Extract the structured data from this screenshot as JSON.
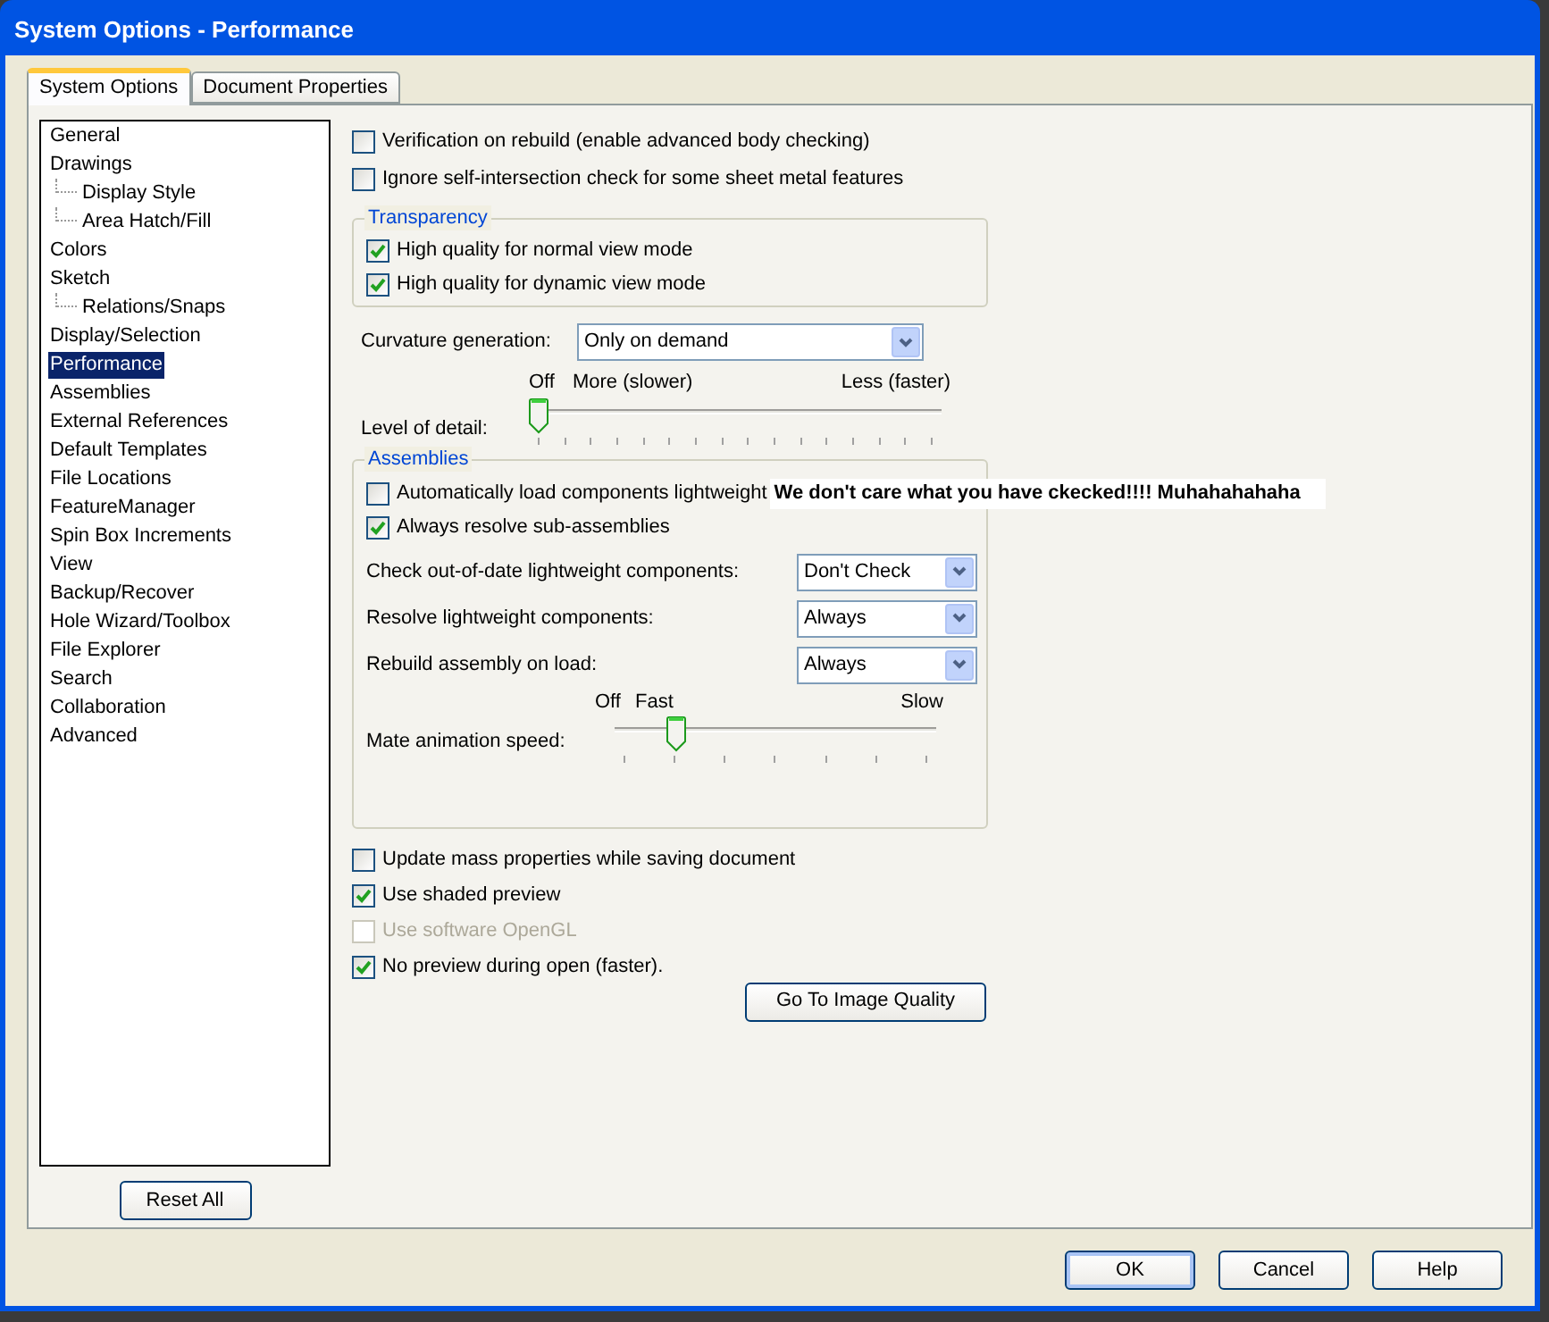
{
  "window": {
    "title": "System Options - Performance"
  },
  "tabs": [
    {
      "label": "System Options",
      "selected": true
    },
    {
      "label": "Document Properties",
      "selected": false
    }
  ],
  "sidebar": {
    "items": [
      {
        "label": "General",
        "selected": false
      },
      {
        "label": "Drawings",
        "selected": false,
        "children": [
          {
            "label": "Display Style",
            "selected": false
          },
          {
            "label": "Area Hatch/Fill",
            "selected": false
          }
        ]
      },
      {
        "label": "Colors",
        "selected": false
      },
      {
        "label": "Sketch",
        "selected": false,
        "children": [
          {
            "label": "Relations/Snaps",
            "selected": false
          }
        ]
      },
      {
        "label": "Display/Selection",
        "selected": false
      },
      {
        "label": "Performance",
        "selected": true
      },
      {
        "label": "Assemblies",
        "selected": false
      },
      {
        "label": "External References",
        "selected": false
      },
      {
        "label": "Default Templates",
        "selected": false
      },
      {
        "label": "File Locations",
        "selected": false
      },
      {
        "label": "FeatureManager",
        "selected": false
      },
      {
        "label": "Spin Box Increments",
        "selected": false
      },
      {
        "label": "View",
        "selected": false
      },
      {
        "label": "Backup/Recover",
        "selected": false
      },
      {
        "label": "Hole Wizard/Toolbox",
        "selected": false
      },
      {
        "label": "File Explorer",
        "selected": false
      },
      {
        "label": "Search",
        "selected": false
      },
      {
        "label": "Collaboration",
        "selected": false
      },
      {
        "label": "Advanced",
        "selected": false
      }
    ],
    "reset_button": "Reset All"
  },
  "top_options": [
    {
      "label": "Verification on rebuild (enable advanced body checking)",
      "checked": false,
      "disabled": false
    },
    {
      "label": "Ignore self-intersection check for some sheet metal features",
      "checked": false,
      "disabled": false
    }
  ],
  "transparency": {
    "title": "Transparency",
    "options": [
      {
        "label": "High quality for normal view mode",
        "checked": true,
        "disabled": false
      },
      {
        "label": "High quality for dynamic view mode",
        "checked": true,
        "disabled": false
      }
    ]
  },
  "curvature": {
    "label": "Curvature generation:",
    "value": "Only on demand"
  },
  "level_of_detail": {
    "label": "Level of detail:",
    "marks": [
      "Off",
      "More (slower)",
      "Less (faster)"
    ],
    "level": 0
  },
  "assemblies": {
    "title": "Assemblies",
    "options": [
      {
        "label": "Automatically load components lightweight",
        "checked": false,
        "disabled": false
      },
      {
        "label": "Always resolve sub-assemblies",
        "checked": true,
        "disabled": false
      }
    ],
    "dropdowns": [
      {
        "label": "Check out-of-date lightweight components:",
        "value": "Don't Check"
      },
      {
        "label": "Resolve lightweight components:",
        "value": "Always"
      },
      {
        "label": "Rebuild assembly on load:",
        "value": "Always"
      }
    ],
    "mate_speed": {
      "label": "Mate animation speed:",
      "marks": [
        "Off",
        "Fast",
        "Slow"
      ],
      "level": 0.17
    }
  },
  "annotation": "We don't care what you have ckecked!!!!  Muhahahahaha",
  "bottom_options": [
    {
      "label": "Update mass properties while saving document",
      "checked": false,
      "disabled": false
    },
    {
      "label": "Use shaded preview",
      "checked": true,
      "disabled": false
    },
    {
      "label": "Use software OpenGL",
      "checked": false,
      "disabled": true
    },
    {
      "label": "No preview during open (faster).",
      "checked": true,
      "disabled": false
    }
  ],
  "image_quality_button": "Go To Image Quality",
  "buttons": [
    "OK",
    "Cancel",
    "Help"
  ]
}
